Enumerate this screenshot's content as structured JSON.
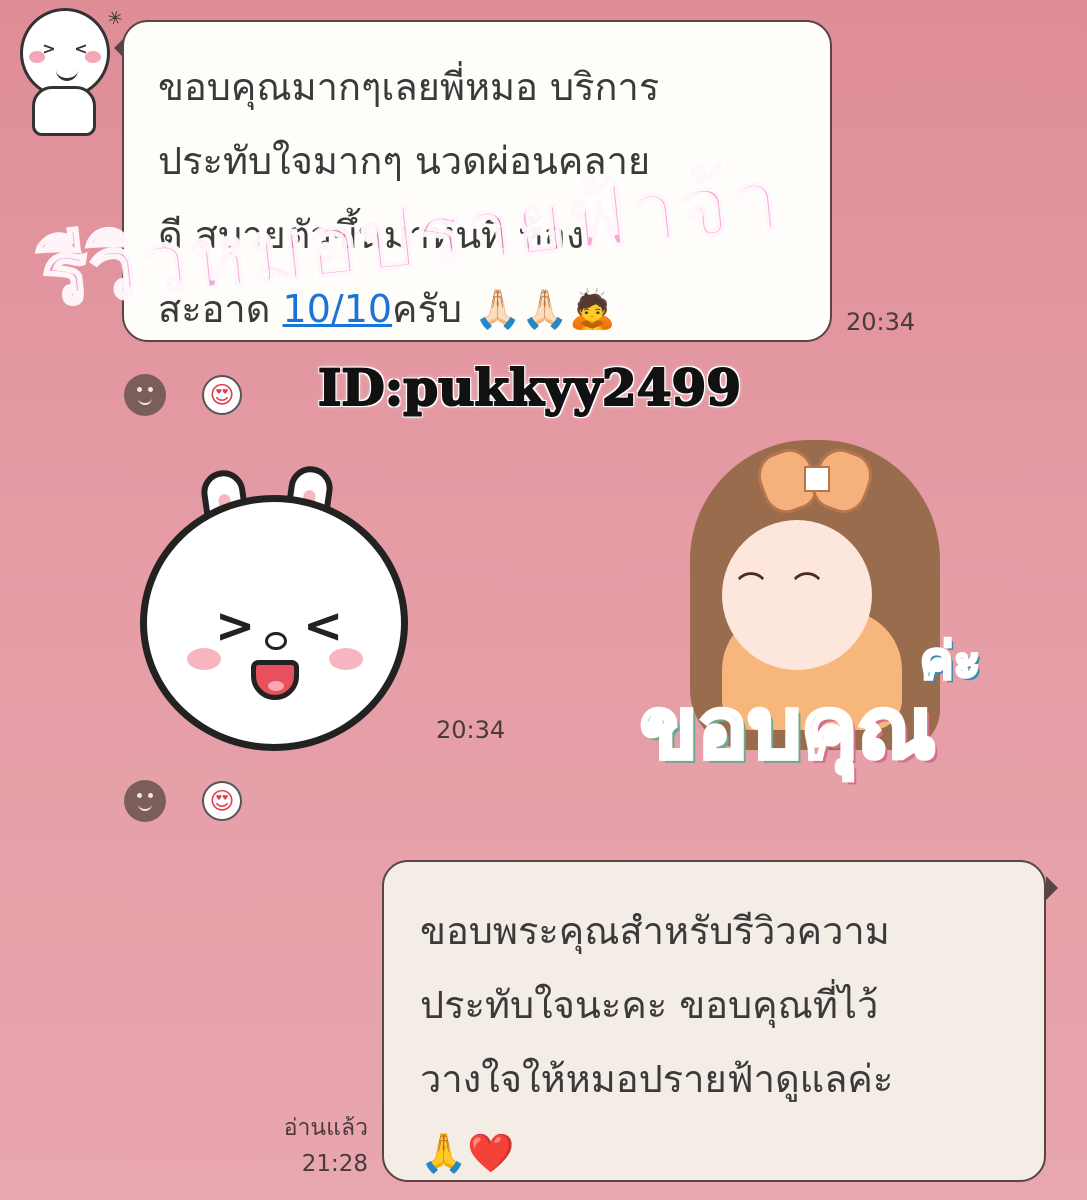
{
  "watermark": "รีวิวหมอปรายฟ้าจ้า",
  "account_id": "ID:pukkyy2499",
  "messages": {
    "incoming1": {
      "lines": [
        "ขอบคุณมากๆเลยพี่หมอ บริการ",
        "ประทับใจมากๆ นวดผ่อนคลาย",
        "ดี สบายตัวขึ้นมาทันที ห้อง"
      ],
      "line4_prefix": "สะอาด ",
      "line4_link": "10/10",
      "line4_suffix": "ครับ 🙏🏻🙏🏻🙇",
      "time": "20:34"
    },
    "incoming_sticker": {
      "time": "20:34"
    },
    "outgoing1": {
      "lines": [
        "ขอบพระคุณสำหรับรีวิวความ",
        "ประทับใจนะคะ ขอบคุณที่ไว้",
        "วางใจให้หมอปรายฟ้าดูแลค่ะ",
        "🙏❤️"
      ],
      "read_label": "อ่านแล้ว",
      "time": "21:28"
    }
  },
  "reactions": {
    "row1": {
      "face": "smile-reaction",
      "love": "heart-eyes-reaction",
      "love_glyph": "😍"
    },
    "row2": {
      "face": "smile-reaction",
      "love": "heart-eyes-reaction",
      "love_glyph": "😍"
    }
  },
  "girl_sticker": {
    "small_text": "ค่ะ",
    "big_text_a": "ขอบ",
    "big_text_b": "คุณ"
  },
  "colors": {
    "background": "#e59ca5",
    "link": "#1a73d6",
    "bubble_outline": "#5a4447"
  }
}
